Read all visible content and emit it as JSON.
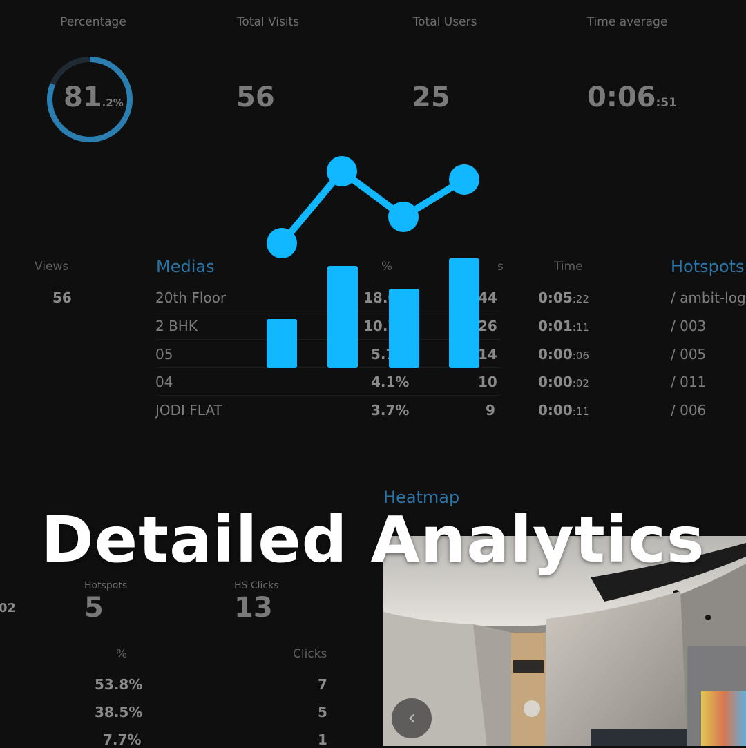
{
  "stats": {
    "percentage": {
      "label": "Percentage",
      "value": "81",
      "suffix": ".2%",
      "fraction": 0.812
    },
    "total_visits": {
      "label": "Total Visits",
      "value": "56"
    },
    "total_users": {
      "label": "Total Users",
      "value": "25"
    },
    "time_average": {
      "label": "Time average",
      "value": "0:06",
      "suffix": ":51"
    }
  },
  "views": {
    "header": "Views",
    "value": "56"
  },
  "medias": {
    "title": "Medias",
    "col_pct": "%",
    "col_views": "s",
    "col_time": "Time",
    "rows": [
      {
        "name": "20th Floor",
        "pct": "18.0",
        "views": "44",
        "time": "0:05",
        "time_sec": ":22"
      },
      {
        "name": "2 BHK",
        "pct": "10.7",
        "views": "26",
        "time": "0:01",
        "time_sec": ":11"
      },
      {
        "name": "05",
        "pct": "5.7",
        "views": "14",
        "time": "0:00",
        "time_sec": ":06"
      },
      {
        "name": "04",
        "pct": "4.1%",
        "views": "10",
        "time": "0:00",
        "time_sec": ":02"
      },
      {
        "name": "JODI FLAT",
        "pct": "3.7%",
        "views": "9",
        "time": "0:00",
        "time_sec": ":11"
      }
    ]
  },
  "hotspots": {
    "title": "Hotspots",
    "rows": [
      "/ ambit-logo",
      "/ 003",
      "/ 005",
      "/ 011",
      "/ 006"
    ]
  },
  "heatmap": {
    "title": "Heatmap",
    "left_fragment": "02",
    "hotspots_label": "Hotspots",
    "hotspots_value": "5",
    "hs_clicks_label": "HS Clicks",
    "hs_clicks_value": "13",
    "col_pct": "%",
    "col_clicks": "Clicks",
    "rows": [
      {
        "pct": "53.8%",
        "clicks": "7"
      },
      {
        "pct": "38.5%",
        "clicks": "5"
      },
      {
        "pct": "7.7%",
        "clicks": "1"
      }
    ]
  },
  "nav": {
    "prev_icon": "chevron-left-icon",
    "prev_glyph": "‹"
  },
  "overlay": {
    "headline": "Detailed Analytics",
    "icon": "analytics-chart-icon",
    "accent": "#12b8ff"
  }
}
